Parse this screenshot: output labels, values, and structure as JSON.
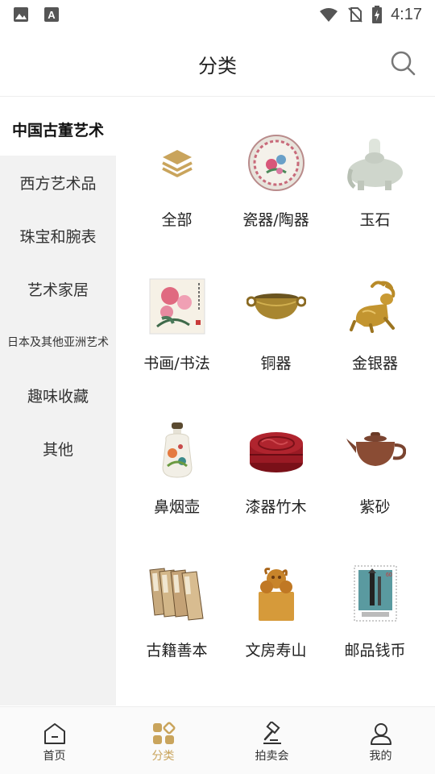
{
  "status_bar": {
    "time": "4:17",
    "icons": [
      "image-icon",
      "text-a-icon",
      "wifi-icon",
      "no-sim-icon",
      "battery-charging-icon"
    ]
  },
  "header": {
    "title": "分类",
    "search_icon": "search-icon"
  },
  "sidebar": {
    "items": [
      {
        "label": "中国古董艺术",
        "active": true
      },
      {
        "label": "西方艺术品"
      },
      {
        "label": "珠宝和腕表"
      },
      {
        "label": "艺术家居"
      },
      {
        "label": "日本及其他亚洲艺术"
      },
      {
        "label": "趣味收藏"
      },
      {
        "label": "其他"
      }
    ]
  },
  "categories": [
    {
      "label": "全部",
      "icon": "layers-icon"
    },
    {
      "label": "瓷器/陶器",
      "icon": "porcelain-plate-image"
    },
    {
      "label": "玉石",
      "icon": "jade-elephant-image"
    },
    {
      "label": "书画/书法",
      "icon": "painting-image"
    },
    {
      "label": "铜器",
      "icon": "bronze-censer-image"
    },
    {
      "label": "金银器",
      "icon": "gold-deer-image"
    },
    {
      "label": "鼻烟壶",
      "icon": "snuff-bottle-image"
    },
    {
      "label": "漆器竹木",
      "icon": "lacquer-box-image"
    },
    {
      "label": "紫砂",
      "icon": "teapot-image"
    },
    {
      "label": "古籍善本",
      "icon": "ancient-books-image"
    },
    {
      "label": "文房寿山",
      "icon": "seal-stone-image"
    },
    {
      "label": "邮品钱币",
      "icon": "stamp-image"
    }
  ],
  "bottom_nav": {
    "items": [
      {
        "label": "首页",
        "icon": "home-icon"
      },
      {
        "label": "分类",
        "icon": "category-icon",
        "active": true
      },
      {
        "label": "拍卖会",
        "icon": "gavel-icon"
      },
      {
        "label": "我的",
        "icon": "user-icon"
      }
    ]
  },
  "colors": {
    "accent": "#c9a45c",
    "sidebar_bg": "#f2f2f2",
    "text": "#222222"
  }
}
